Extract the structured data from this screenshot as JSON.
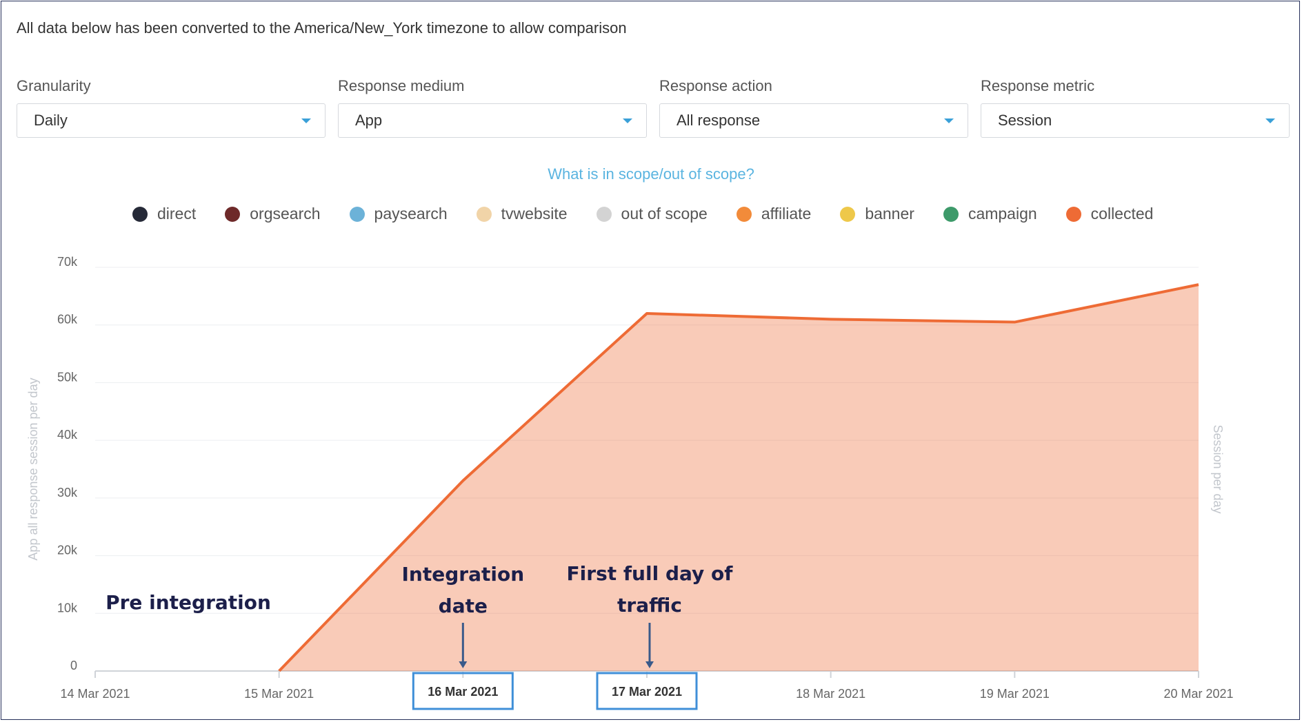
{
  "notice": "All data below has been converted to the America/New_York timezone to allow comparison",
  "filters": [
    {
      "label": "Granularity",
      "value": "Daily"
    },
    {
      "label": "Response medium",
      "value": "App"
    },
    {
      "label": "Response action",
      "value": "All response"
    },
    {
      "label": "Response metric",
      "value": "Session"
    }
  ],
  "scope_link": "What is in scope/out of scope?",
  "legend": [
    {
      "label": "direct",
      "color": "#262a38"
    },
    {
      "label": "orgsearch",
      "color": "#6e2a2a"
    },
    {
      "label": "paysearch",
      "color": "#6cb2d8"
    },
    {
      "label": "tvwebsite",
      "color": "#f1d4a8"
    },
    {
      "label": "out of scope",
      "color": "#d3d3d3"
    },
    {
      "label": "affiliate",
      "color": "#f28b3a"
    },
    {
      "label": "banner",
      "color": "#eec84a"
    },
    {
      "label": "campaign",
      "color": "#3d9a6a"
    },
    {
      "label": "collected",
      "color": "#ee6b35"
    }
  ],
  "chart_data": {
    "type": "area",
    "x": [
      "14 Mar 2021",
      "15 Mar 2021",
      "16 Mar 2021",
      "17 Mar 2021",
      "18 Mar 2021",
      "19 Mar 2021",
      "20 Mar 2021"
    ],
    "series": [
      {
        "name": "collected",
        "color": "#ee6b35",
        "values": [
          0,
          0,
          33000,
          62000,
          61000,
          60500,
          67000
        ]
      }
    ],
    "yticks": [
      "0",
      "10k",
      "20k",
      "30k",
      "40k",
      "50k",
      "60k",
      "70k"
    ],
    "ylim": [
      0,
      70000
    ],
    "ylabel": "App all response session per day",
    "ylabel_right": "Session per day",
    "grid": true,
    "annotations": [
      {
        "lines": [
          "Pre integration"
        ]
      },
      {
        "lines": [
          "Integration",
          "date"
        ],
        "target": "16 Mar 2021"
      },
      {
        "lines": [
          "First full day of",
          "traffic"
        ],
        "target": "17 Mar 2021"
      }
    ],
    "highlighted_ticks": [
      "16 Mar 2021",
      "17 Mar 2021"
    ]
  }
}
